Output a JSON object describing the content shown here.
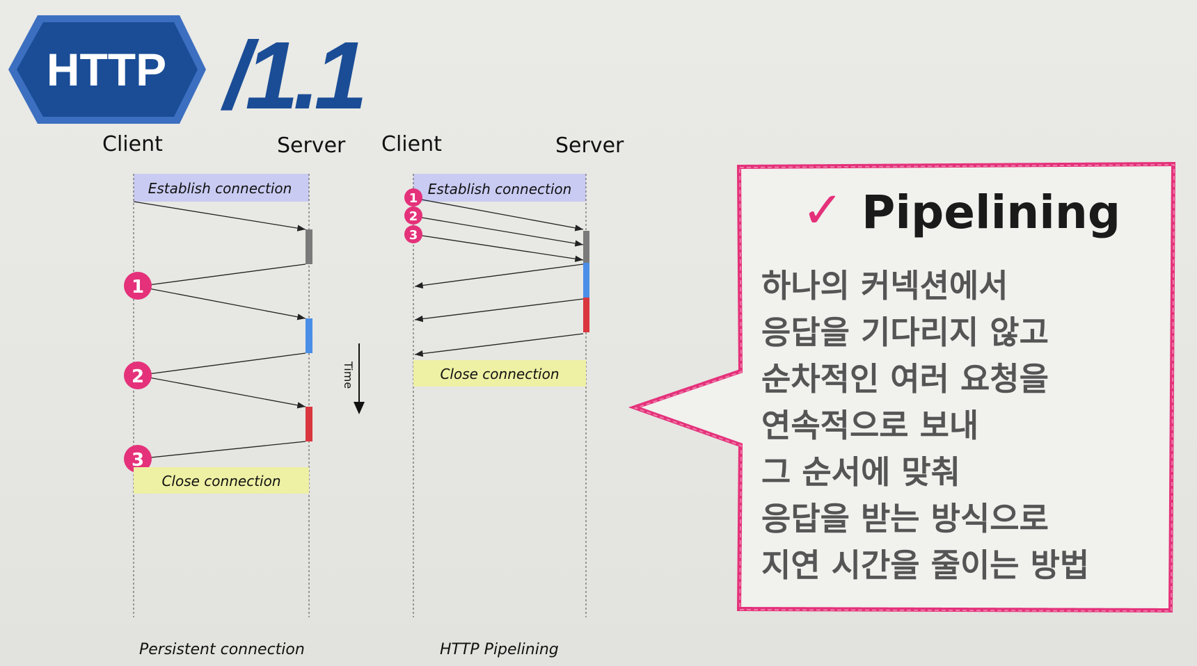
{
  "header": {
    "protocol": "HTTP",
    "version": "/1.1"
  },
  "diagram_persistent": {
    "client_label": "Client",
    "server_label": "Server",
    "establish": "Establish  connection",
    "close": "Close  connection",
    "caption": "Persistent  connection",
    "markers": [
      "1",
      "2",
      "3"
    ]
  },
  "time_label": "Time",
  "diagram_pipelining": {
    "client_label": "Client",
    "server_label": "Server",
    "establish": "Establish  connection",
    "close": "Close  connection",
    "caption": "HTTP  Pipelining",
    "markers": [
      "1",
      "2",
      "3"
    ]
  },
  "callout": {
    "check": "✓",
    "title": "Pipelining",
    "lines": [
      "하나의 커넥션에서",
      "응답을 기다리지 않고",
      "순차적인 여러 요청을",
      "연속적으로 보내",
      "그 순서에 맞춰",
      "응답을 받는 방식으로",
      "지연 시간을 줄이는 방법"
    ]
  },
  "colors": {
    "brand_blue": "#1a4d96",
    "logo_border": "#3c6fc0",
    "marker_pink": "#e4317a",
    "establish_bg": "#c9cbf2",
    "close_bg": "#eef0a4",
    "bar_gray": "#7a7a7a",
    "bar_blue": "#4a8ee8",
    "bar_red": "#d9363e"
  }
}
